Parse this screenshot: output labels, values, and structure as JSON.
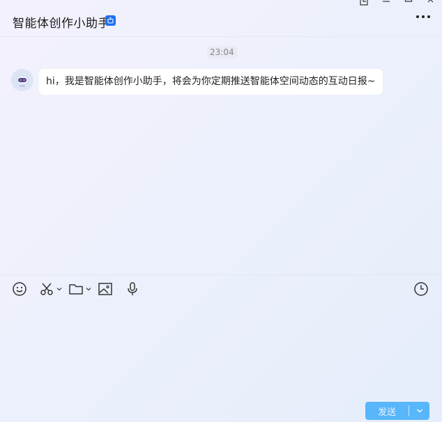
{
  "window": {
    "controls": [
      "pin-window-icon",
      "minimize-icon",
      "maximize-icon",
      "close-icon"
    ]
  },
  "header": {
    "title": "智能体创作小助手",
    "badge_icon": "bot-badge-icon",
    "more_icon": "more-icon"
  },
  "chat": {
    "timestamp": "23:04",
    "messages": [
      {
        "sender_avatar": "robot-avatar",
        "text": "hi，我是智能体创作小助手，将会为你定期推送智能体空间动态的互动日报~"
      }
    ]
  },
  "toolbar": {
    "tools": [
      "emoji-icon",
      "screenshot-icon",
      "folder-icon",
      "image-icon",
      "microphone-icon"
    ],
    "history_icon": "clock-icon"
  },
  "composer": {
    "value": "",
    "placeholder": ""
  },
  "send": {
    "label": "发送",
    "dropdown_icon": "chevron-down-icon"
  },
  "colors": {
    "accent": "#1f6ff2",
    "send_button": "#58b6fb",
    "bubble": "#ffffff"
  }
}
